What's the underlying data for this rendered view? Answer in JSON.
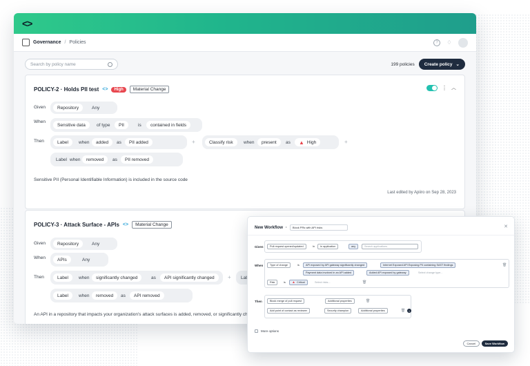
{
  "app": {
    "logo": "<>"
  },
  "breadcrumb": {
    "section": "Governance",
    "separator": "/",
    "page": "Policies"
  },
  "search": {
    "placeholder": "Search by policy name"
  },
  "policy_count": "199 policies",
  "create_policy_label": "Create policy",
  "policy1": {
    "title": "POLICY-2 · Holds PII test",
    "severity": "High",
    "tag": "Material Change",
    "given_label": "Given",
    "given_field": "Repository",
    "given_value": "Any",
    "when_label": "When",
    "when_subject": "Sensitive data",
    "when_oftype": "of type",
    "when_type": "PII",
    "when_is": "is",
    "when_condition": "contained in fields",
    "then_label": "Then",
    "a1_label": "Label",
    "a1_when": "when",
    "a1_state": "added",
    "a1_as": "as",
    "a1_value": "PII added",
    "a2_label": "Classify risk",
    "a2_when": "when",
    "a2_state": "present",
    "a2_as": "as",
    "a2_value": "High",
    "a3_label": "Label",
    "a3_when": "when",
    "a3_state": "removed",
    "a3_as": "as",
    "a3_value": "PII removed",
    "description": "Sensitive PII (Personal Identifiable Information) is included in the source code",
    "edited": "Last edited by Apiiro on Sep 28, 2023",
    "enabled": true
  },
  "policy2": {
    "title": "POLICY-3 · Attack Surface - APIs",
    "tag": "Material Change",
    "given_label": "Given",
    "given_field": "Repository",
    "given_value": "Any",
    "when_label": "When",
    "when_subject": "APIs",
    "when_value": "Any",
    "then_label": "Then",
    "a1_label": "Label",
    "a1_when": "when",
    "a1_state": "significantly changed",
    "a1_as": "as",
    "a1_value": "API significantly changed",
    "a2_label": "Lab",
    "a3_label": "Label",
    "a3_when": "when",
    "a3_state": "removed",
    "a3_as": "as",
    "a3_value": "API removed",
    "description": "An API in a repository that impacts your organization's attack surfaces is added, removed, or significantly ch"
  },
  "workflow": {
    "title": "New Workflow",
    "name_value": "Block PRs with API risks",
    "given_label": "Given",
    "given_trigger": "Pull request opened/updated",
    "given_in": "In",
    "given_scope": "In application",
    "given_any": "any",
    "given_placeholder": "Search applications",
    "when_label": "When",
    "when_field": "Type of change",
    "when_is": "is",
    "when_chips": [
      "API exposed by API gateway significantly changed",
      "Internet Exposed API Exposing PII containing SAST findings",
      "Payment data involved in an API added",
      "Added API exposed by gateway"
    ],
    "when_placeholder": "Select change type...",
    "risk_field": "Risk",
    "risk_is": "is",
    "risk_chip": "Critical",
    "risk_placeholder": "Select risks...",
    "then_label": "Then",
    "then_action1": "Block merge of pull request",
    "then_action1_props": "Additional properties",
    "then_action2": "Add point of contact as reviewer",
    "then_action2_value": "Security champion",
    "then_action2_props": "Additional properties",
    "more_options": "More options",
    "cancel": "Cancel",
    "save": "Save Workflow"
  }
}
